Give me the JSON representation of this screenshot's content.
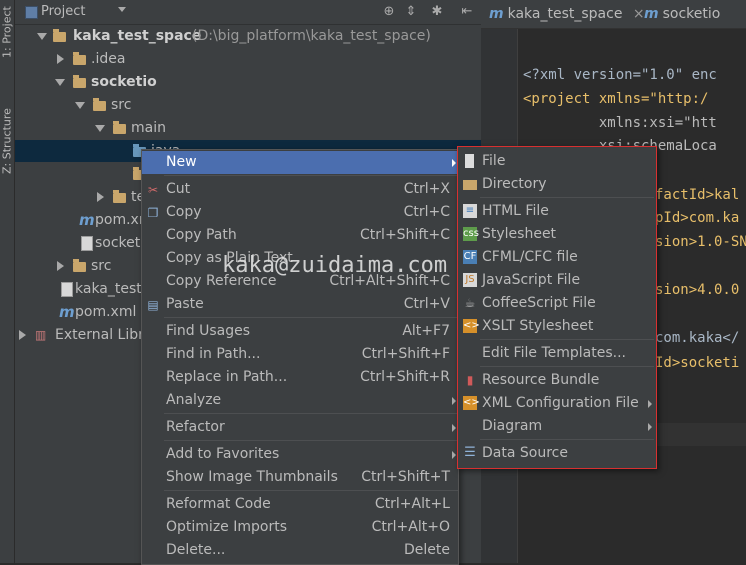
{
  "side_tabs": {
    "project": "1: Project",
    "structure": "Z: Structure"
  },
  "project_panel": {
    "title": "Project",
    "tree": [
      {
        "label": "kaka_test_space",
        "suffix": "(D:\\big_platform\\kaka_test_space)"
      },
      {
        "label": ".idea"
      },
      {
        "label": "socketio"
      },
      {
        "label": "src"
      },
      {
        "label": "main"
      },
      {
        "label": "java"
      },
      {
        "label": "r"
      },
      {
        "label": "test"
      },
      {
        "label": "pom.xr"
      },
      {
        "label": "socketi"
      },
      {
        "label": "src"
      },
      {
        "label": "kaka_test_"
      },
      {
        "label": "pom.xml"
      },
      {
        "label": "External Libra"
      }
    ]
  },
  "editor_tabs": [
    {
      "label": "kaka_test_space",
      "close": "×"
    },
    {
      "label": "socketio"
    }
  ],
  "code_lines": [
    "<?xml version=\"1.0\" enc",
    "<project xmlns=\"http:/",
    "         xmlns:xsi=\"htt",
    "         xsi:schemaLoca",
    "factId>kal",
    "pId>com.ka",
    "sion>1.0-SN",
    "sion>4.0.0",
    "com.kaka</",
    "Id>socketi"
  ],
  "context_menu": {
    "items": [
      {
        "label": "New",
        "shortcut": ""
      },
      {
        "label": "Cut",
        "shortcut": "Ctrl+X"
      },
      {
        "label": "Copy",
        "shortcut": "Ctrl+C"
      },
      {
        "label": "Copy Path",
        "shortcut": "Ctrl+Shift+C"
      },
      {
        "label": "Copy as Plain Text",
        "shortcut": ""
      },
      {
        "label": "Copy Reference",
        "shortcut": "Ctrl+Alt+Shift+C"
      },
      {
        "label": "Paste",
        "shortcut": "Ctrl+V"
      },
      {
        "label": "Find Usages",
        "shortcut": "Alt+F7"
      },
      {
        "label": "Find in Path...",
        "shortcut": "Ctrl+Shift+F"
      },
      {
        "label": "Replace in Path...",
        "shortcut": "Ctrl+Shift+R"
      },
      {
        "label": "Analyze",
        "shortcut": ""
      },
      {
        "label": "Refactor",
        "shortcut": ""
      },
      {
        "label": "Add to Favorites",
        "shortcut": ""
      },
      {
        "label": "Show Image Thumbnails",
        "shortcut": "Ctrl+Shift+T"
      },
      {
        "label": "Reformat Code",
        "shortcut": "Ctrl+Alt+L"
      },
      {
        "label": "Optimize Imports",
        "shortcut": "Ctrl+Alt+O"
      },
      {
        "label": "Delete...",
        "shortcut": "Delete"
      }
    ]
  },
  "new_submenu": {
    "items": [
      {
        "label": "File"
      },
      {
        "label": "Directory"
      },
      {
        "label": "HTML File"
      },
      {
        "label": "Stylesheet"
      },
      {
        "label": "CFML/CFC file"
      },
      {
        "label": "JavaScript File"
      },
      {
        "label": "CoffeeScript File"
      },
      {
        "label": "XSLT Stylesheet"
      },
      {
        "label": "Edit File Templates..."
      },
      {
        "label": "Resource Bundle"
      },
      {
        "label": "XML Configuration File"
      },
      {
        "label": "Diagram"
      },
      {
        "label": "Data Source"
      }
    ]
  },
  "watermark": "kaka@zuidaima.com",
  "colors": {
    "highlight": "#4b6eaf",
    "submenu_border": "#d83030",
    "selection": "#0d293e"
  }
}
